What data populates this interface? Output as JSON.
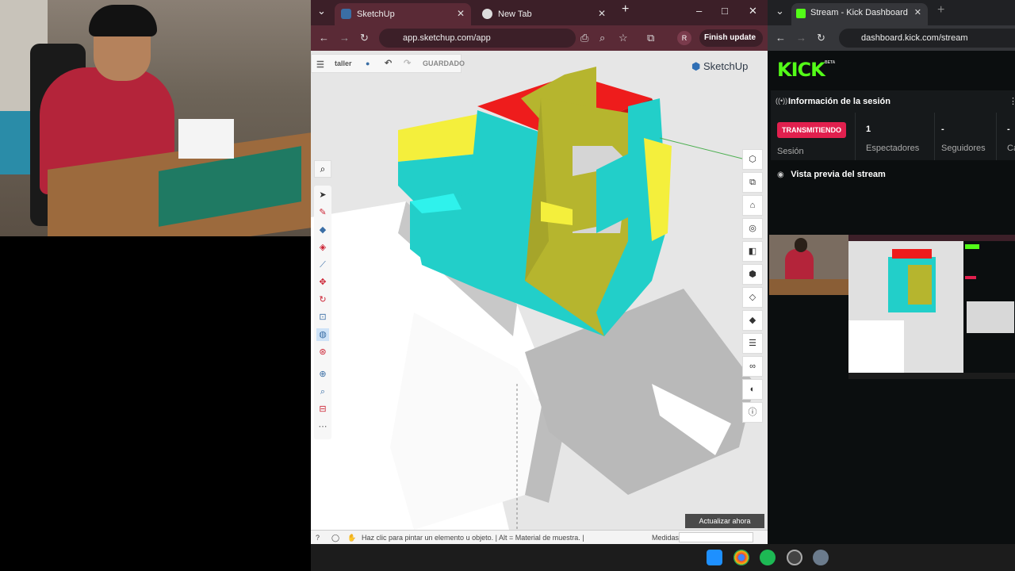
{
  "sketchup_browser": {
    "tabs": [
      {
        "label": "SketchUp",
        "close": "✕"
      },
      {
        "label": "New Tab",
        "close": "✕"
      }
    ],
    "new_tab": "+",
    "window_controls": {
      "minimize": "–",
      "maximize": "□",
      "close": "✕"
    },
    "url": "app.sketchup.com/app",
    "profile": "R",
    "finish_update": "Finish update"
  },
  "sketchup": {
    "project_name": "taller",
    "save_state": "GUARDADO",
    "logo": "SketchUp",
    "status_text": "Haz clic para pintar un elemento u objeto. | Alt = Material de muestra. |",
    "measures_label": "Medidas",
    "update_button": "Actualizar ahora",
    "left_tools": [
      "search-icon",
      "select-icon",
      "pencil-icon",
      "eraser-icon",
      "paint-icon",
      "line-icon",
      "move-icon",
      "rotate-icon",
      "scale-icon",
      "paint-bucket-icon",
      "tape-icon",
      "orbit-icon",
      "zoom-icon",
      "section-icon",
      "more-icon"
    ],
    "right_tools": [
      "cube-icon",
      "components-icon",
      "scenes-icon",
      "styles-icon",
      "views-icon",
      "outliner-icon",
      "eraser-icon",
      "tag-icon",
      "solid-icon",
      "glasses-icon",
      "display-icon",
      "info-icon"
    ]
  },
  "kick_browser": {
    "tab_label": "Stream - Kick Dashboard",
    "close": "✕",
    "new_tab": "+",
    "url": "dashboard.kick.com/stream"
  },
  "kick": {
    "logo": "KICK",
    "beta": "BETA",
    "session_info_title": "Información de la sesión",
    "live_badge": "TRANSMITIENDO",
    "session_label": "Sesión",
    "stats": [
      {
        "value": "1",
        "label": "Espectadores"
      },
      {
        "value": "-",
        "label": "Seguidores"
      },
      {
        "value": "-",
        "label": "Ca"
      }
    ],
    "preview_title": "Vista previa del stream"
  },
  "colors": {
    "kick_green": "#53fc18",
    "live_red": "#e1204e",
    "model_cyan": "#22cfc9",
    "model_yellow": "#b6b52e",
    "model_red": "#ee1c1c"
  }
}
